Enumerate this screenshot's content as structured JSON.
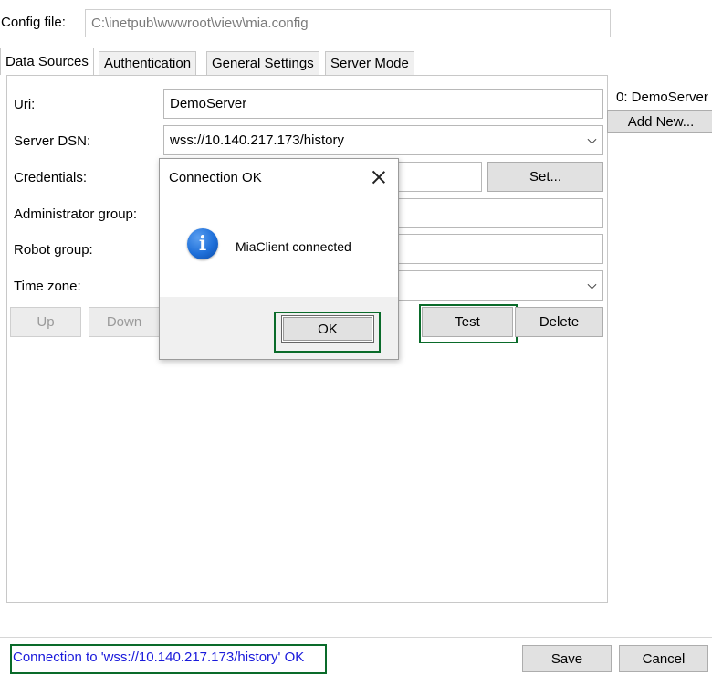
{
  "config": {
    "label": "Config file:",
    "path": "C:\\inetpub\\wwwroot\\view\\mia.config"
  },
  "tabs": [
    {
      "label": "Data Sources",
      "active": true
    },
    {
      "label": "Authentication",
      "active": false
    },
    {
      "label": "General Settings",
      "active": false
    },
    {
      "label": "Server Mode",
      "active": false
    }
  ],
  "form": {
    "uri_label": "Uri:",
    "uri_value": "DemoServer",
    "dsn_label": "Server DSN:",
    "dsn_value": "wss://10.140.217.173/history",
    "credentials_label": "Credentials:",
    "credentials_value": "",
    "set_button": "Set...",
    "admin_group_label": "Administrator group:",
    "admin_group_value": "",
    "robot_group_label": "Robot group:",
    "robot_group_value": "",
    "timezone_label": "Time zone:",
    "timezone_value": ""
  },
  "buttons": {
    "up": "Up",
    "down": "Down",
    "test": "Test",
    "delete": "Delete",
    "save": "Save",
    "cancel": "Cancel"
  },
  "server_list": {
    "items": [
      "0: DemoServer"
    ],
    "add_new": "Add New..."
  },
  "dialog": {
    "title": "Connection OK",
    "message": "MiaClient connected",
    "ok": "OK",
    "icon": "info-icon"
  },
  "status": {
    "text": "Connection to 'wss://10.140.217.173/history' OK",
    "color": "#1a1adb"
  },
  "colors": {
    "highlight": "#0a6b2a",
    "dialog_footer": "#f0f0f0",
    "button_face": "#e1e1e1"
  }
}
